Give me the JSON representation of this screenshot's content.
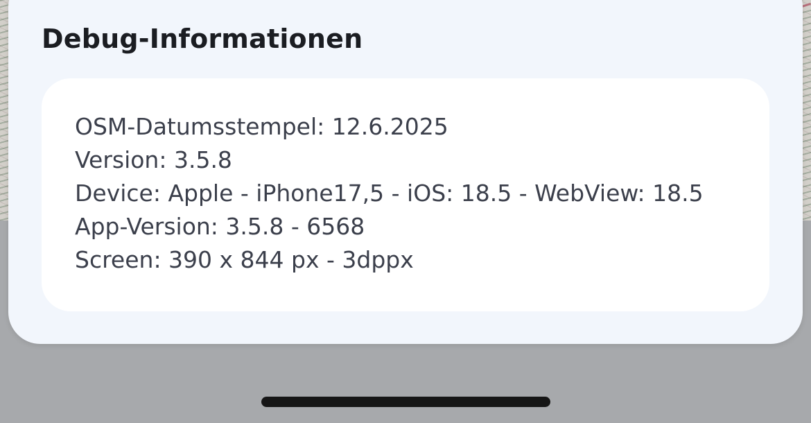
{
  "sheet": {
    "title": "Debug-Informationen",
    "lines": [
      "OSM-Datumsstempel: 12.6.2025",
      "Version: 3.5.8",
      "Device: Apple - iPhone17,5 - iOS: 18.5 - WebView: 18.5",
      "App-Version: 3.5.8 - 6568",
      "Screen: 390 x 844 px - 3dppx"
    ]
  },
  "colors": {
    "sheet_background": "#f2f6fc",
    "card_background": "#ffffff",
    "title_text": "#1b1d22",
    "body_text": "#3b3f4b",
    "dim_background": "#a7a9ac",
    "home_indicator": "#161616"
  }
}
